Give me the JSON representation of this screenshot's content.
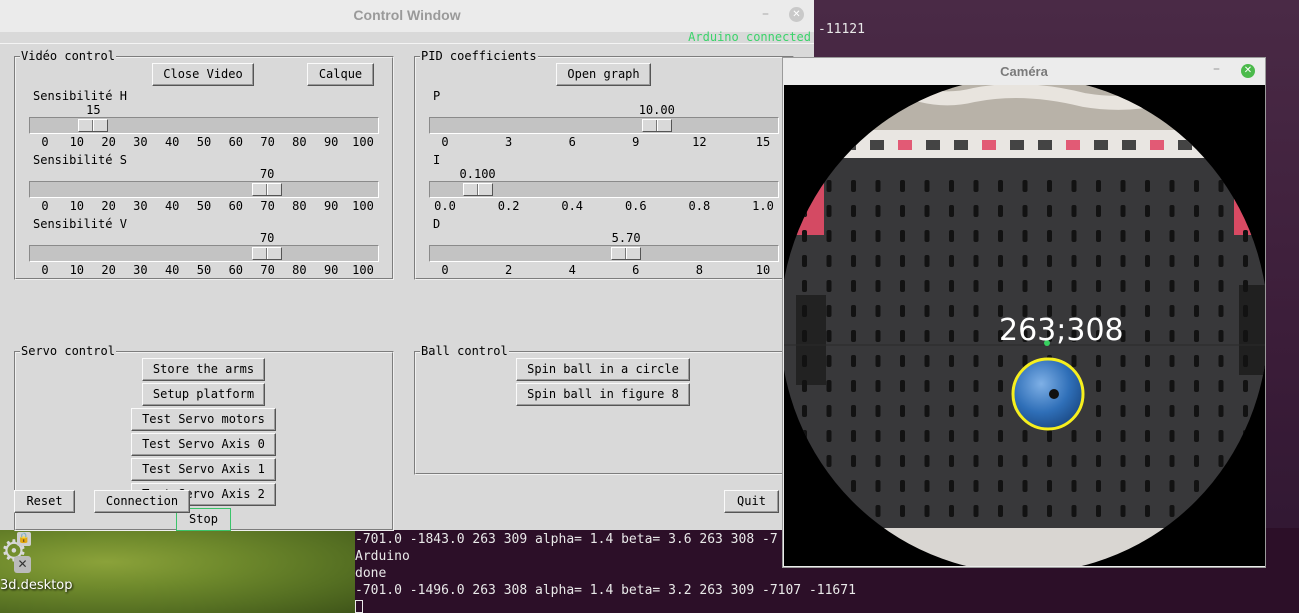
{
  "desktop": {
    "icon_label": "3d.desktop",
    "icon_glyph": "⚙",
    "close_glyph": "✕",
    "lock_glyph": "🔒"
  },
  "terminal": {
    "top_fragment": "-11121",
    "lines": [
      "-701.0 -1843.0 263 309 alpha= 1.4 beta= 3.6 263 308 -7",
      "Arduino",
      "done",
      "-701.0 -1496.0 263 308 alpha= 1.4 beta= 3.2 263 309 -7107 -11671"
    ]
  },
  "control_window": {
    "title": "Control Window",
    "minimize_glyph": "–",
    "close_glyph": "✕",
    "status": "Arduino connected",
    "video_control": {
      "label": "Vidéo control",
      "close_video": "Close Video",
      "calque": "Calque",
      "sliders": [
        {
          "label": "Sensibilité H",
          "value_text": "15",
          "fraction": 0.15,
          "ticks": [
            "0",
            "10",
            "20",
            "30",
            "40",
            "50",
            "60",
            "70",
            "80",
            "90",
            "100"
          ]
        },
        {
          "label": "Sensibilité S",
          "value_text": "70",
          "fraction": 0.7,
          "ticks": [
            "0",
            "10",
            "20",
            "30",
            "40",
            "50",
            "60",
            "70",
            "80",
            "90",
            "100"
          ]
        },
        {
          "label": "Sensibilité V",
          "value_text": "70",
          "fraction": 0.7,
          "ticks": [
            "0",
            "10",
            "20",
            "30",
            "40",
            "50",
            "60",
            "70",
            "80",
            "90",
            "100"
          ]
        }
      ]
    },
    "pid": {
      "label": "PID coefficients",
      "open_graph": "Open graph",
      "sliders": [
        {
          "label": "P",
          "value_text": "10.00",
          "fraction": 0.667,
          "ticks": [
            "0",
            "3",
            "6",
            "9",
            "12",
            "15"
          ]
        },
        {
          "label": "I",
          "value_text": "0.100",
          "fraction": 0.1,
          "ticks": [
            "0.0",
            "0.2",
            "0.4",
            "0.6",
            "0.8",
            "1.0"
          ]
        },
        {
          "label": "D",
          "value_text": "5.70",
          "fraction": 0.57,
          "ticks": [
            "0",
            "2",
            "4",
            "6",
            "8",
            "10"
          ]
        }
      ]
    },
    "servo_control": {
      "label": "Servo control",
      "buttons": [
        "Store the arms",
        "Setup platform",
        "Test Servo motors",
        "Test Servo Axis 0",
        "Test Servo Axis 1",
        "Test Servo Axis 2"
      ]
    },
    "ball_control": {
      "label": "Ball control",
      "buttons": [
        "Spin ball in a circle",
        "Spin ball in figure 8"
      ]
    },
    "reset": "Reset",
    "connection": "Connection",
    "stop": "Stop",
    "quit": "Quit"
  },
  "camera_window": {
    "title": "Caméra",
    "minimize_glyph": "–",
    "close_glyph": "✕",
    "coords": "263;308"
  }
}
